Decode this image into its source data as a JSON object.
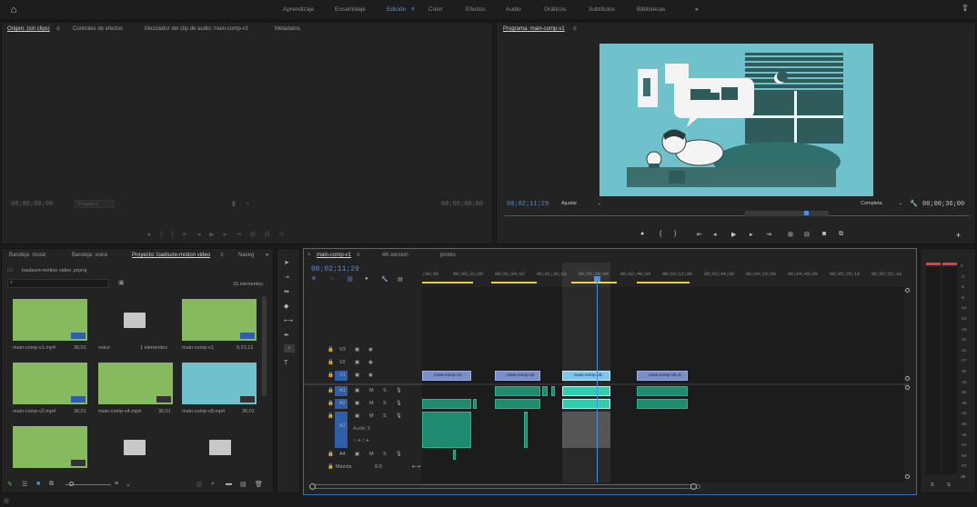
{
  "workspaces": [
    "Aprendizaje",
    "Ensamblaje",
    "Edición",
    "Color",
    "Efectos",
    "Audio",
    "Gráficos",
    "Subtítulos",
    "Bibliotecas"
  ],
  "workspace_active": "Edición",
  "more": "»",
  "source": {
    "tabs": [
      "Origen: (sin clips)",
      "Controles de efectos",
      "Mezclador del clip de audio: main-comp-v1",
      "Metadatos"
    ],
    "timecode_left": "00;00;00;00",
    "page_label": "Página 1",
    "timecode_right": "00;00;00;00"
  },
  "program": {
    "tab": "Programa: main-comp-v1",
    "timecode": "00;02;11;29",
    "fit": "Ajustar",
    "quality": "Completa",
    "duration": "00;00;36;00"
  },
  "project": {
    "tabs": [
      "Bandeja: music",
      "Bandeja: voice",
      "Proyecto: loadsure-motion video",
      "Naveg"
    ],
    "file": "loadsure-motion video .prproj",
    "count": "15 elementos",
    "items": [
      {
        "name": "main-comp-v1.mp4",
        "duration": "36;01",
        "kind": "video",
        "color": "green"
      },
      {
        "name": "voice",
        "duration": "1 elementos",
        "kind": "folder"
      },
      {
        "name": "main-comp-v1",
        "duration": "5;21;12",
        "kind": "video",
        "color": "green"
      },
      {
        "name": "main-comp-v2.mp4",
        "duration": "36;01",
        "kind": "video",
        "color": "green"
      },
      {
        "name": "main-comp-v4.mp4",
        "duration": "36;01",
        "kind": "video",
        "color": "green"
      },
      {
        "name": "main-comp-v8.mp4",
        "duration": "36;01",
        "kind": "video",
        "color": "teal"
      },
      {
        "name": "",
        "duration": "",
        "kind": "video",
        "color": "green"
      },
      {
        "name": "",
        "duration": "",
        "kind": "folder"
      },
      {
        "name": "",
        "duration": "",
        "kind": "folder"
      }
    ]
  },
  "timeline": {
    "tabs": [
      "main-comp-v1",
      "4K-version",
      "prores"
    ],
    "timecode": "00;02;11;29",
    "ruler": [
      ";00;00",
      "00;00;32;00",
      "00;01;04;02",
      "00;01;36;02",
      "00;02;08;04",
      "00;02;40;04",
      "00;03;12;06",
      "00;03;44;06",
      "00;04;16;08",
      "00;04;48;08",
      "00;05;20;10",
      "00;05;52;10"
    ],
    "tracks_video": [
      "V3",
      "V2",
      "V1"
    ],
    "tracks_audio": [
      "A1",
      "A2",
      "A3",
      "A4"
    ],
    "audio3_name": "Audio 3",
    "mix_label": "Mezcla",
    "mix_value": "0.0",
    "clips": [
      "main-comp-v1",
      "main-comp-v2",
      "main-comp-v8.",
      "main-comp-v5.m"
    ]
  },
  "meter_scale": [
    "0",
    "-3",
    "-6",
    "-9",
    "-12",
    "-15",
    "-18",
    "-21",
    "-24",
    "-27",
    "-30",
    "-33",
    "-36",
    "-39",
    "-42",
    "-45",
    "-48",
    "-51",
    "-54",
    "-57",
    "dB"
  ],
  "meter_solo": [
    "S",
    "S"
  ]
}
